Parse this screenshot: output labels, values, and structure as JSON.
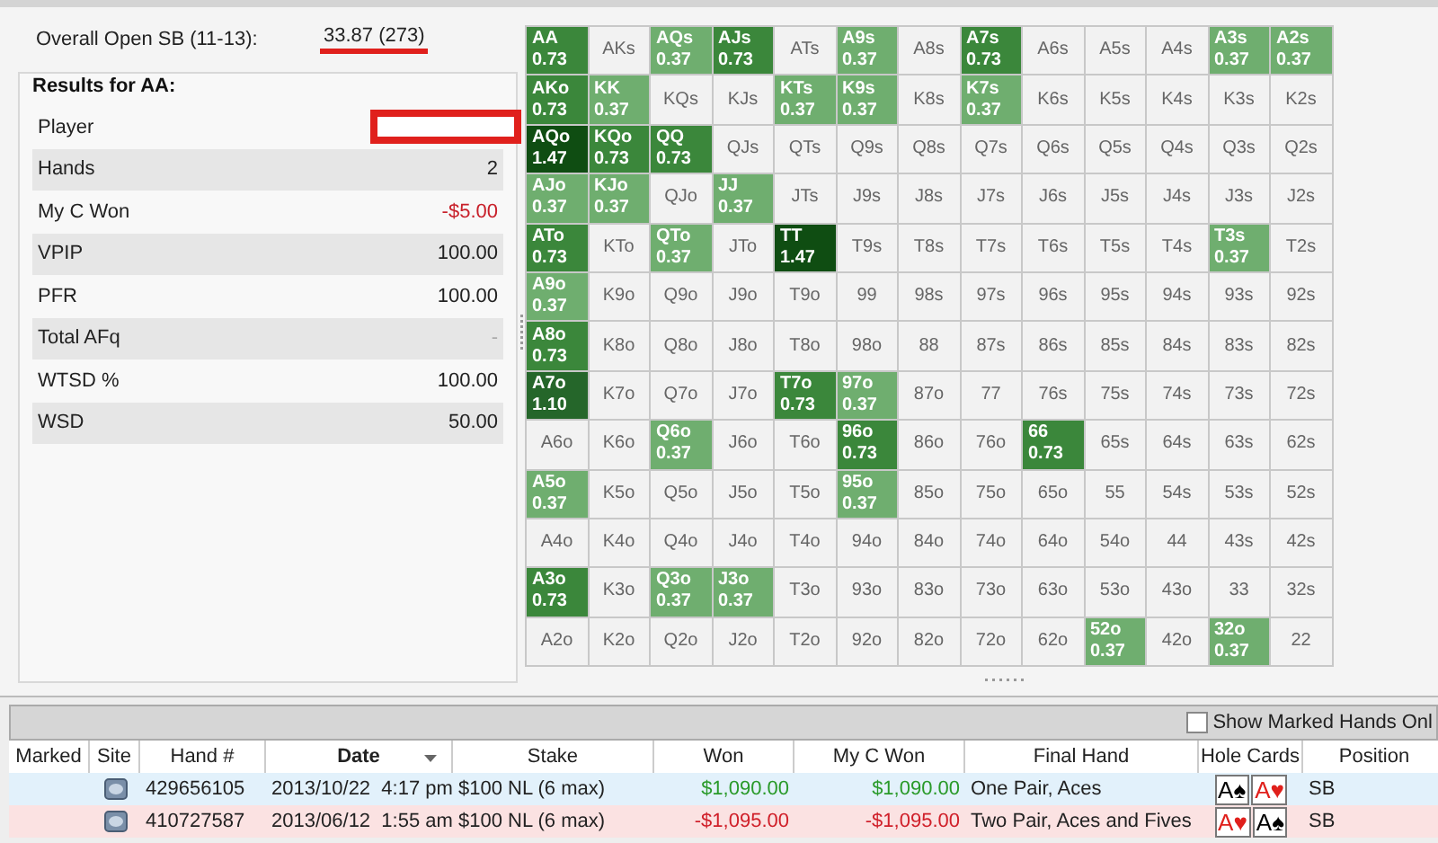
{
  "summary": {
    "label": "Overall Open SB (11-13):",
    "value": "33.87 (273)"
  },
  "results": {
    "title": "Results for AA:",
    "rows": [
      {
        "label": "Player",
        "kind": "redacted"
      },
      {
        "label": "Hands",
        "value": "2",
        "kind": "plain"
      },
      {
        "label": "My C Won",
        "value": "-$5.00",
        "kind": "negative"
      },
      {
        "label": "VPIP",
        "value": "100.00",
        "kind": "plain"
      },
      {
        "label": "PFR",
        "value": "100.00",
        "kind": "plain"
      },
      {
        "label": "Total AFq",
        "value": "-",
        "kind": "muted"
      },
      {
        "label": "WTSD %",
        "value": "100.00",
        "kind": "plain"
      },
      {
        "label": "WSD",
        "value": "50.00",
        "kind": "plain"
      }
    ]
  },
  "grid": [
    [
      {
        "hand": "AA",
        "value": "0.73",
        "color": "#3b873b"
      },
      {
        "hand": "AKs"
      },
      {
        "hand": "AQs",
        "value": "0.37",
        "color": "#6fae6f"
      },
      {
        "hand": "AJs",
        "value": "0.73",
        "color": "#3b873b"
      },
      {
        "hand": "ATs"
      },
      {
        "hand": "A9s",
        "value": "0.37",
        "color": "#6fae6f"
      },
      {
        "hand": "A8s"
      },
      {
        "hand": "A7s",
        "value": "0.73",
        "color": "#3b873b"
      },
      {
        "hand": "A6s"
      },
      {
        "hand": "A5s"
      },
      {
        "hand": "A4s"
      },
      {
        "hand": "A3s",
        "value": "0.37",
        "color": "#6fae6f"
      },
      {
        "hand": "A2s",
        "value": "0.37",
        "color": "#6fae6f"
      }
    ],
    [
      {
        "hand": "AKo",
        "value": "0.73",
        "color": "#3b873b"
      },
      {
        "hand": "KK",
        "value": "0.37",
        "color": "#6fae6f"
      },
      {
        "hand": "KQs"
      },
      {
        "hand": "KJs"
      },
      {
        "hand": "KTs",
        "value": "0.37",
        "color": "#6fae6f"
      },
      {
        "hand": "K9s",
        "value": "0.37",
        "color": "#6fae6f"
      },
      {
        "hand": "K8s"
      },
      {
        "hand": "K7s",
        "value": "0.37",
        "color": "#6fae6f"
      },
      {
        "hand": "K6s"
      },
      {
        "hand": "K5s"
      },
      {
        "hand": "K4s"
      },
      {
        "hand": "K3s"
      },
      {
        "hand": "K2s"
      }
    ],
    [
      {
        "hand": "AQo",
        "value": "1.47",
        "color": "#0f4d12"
      },
      {
        "hand": "KQo",
        "value": "0.73",
        "color": "#3b873b"
      },
      {
        "hand": "QQ",
        "value": "0.73",
        "color": "#3b873b"
      },
      {
        "hand": "QJs"
      },
      {
        "hand": "QTs"
      },
      {
        "hand": "Q9s"
      },
      {
        "hand": "Q8s"
      },
      {
        "hand": "Q7s"
      },
      {
        "hand": "Q6s"
      },
      {
        "hand": "Q5s"
      },
      {
        "hand": "Q4s"
      },
      {
        "hand": "Q3s"
      },
      {
        "hand": "Q2s"
      }
    ],
    [
      {
        "hand": "AJo",
        "value": "0.37",
        "color": "#6fae6f"
      },
      {
        "hand": "KJo",
        "value": "0.37",
        "color": "#6fae6f"
      },
      {
        "hand": "QJo"
      },
      {
        "hand": "JJ",
        "value": "0.37",
        "color": "#6fae6f"
      },
      {
        "hand": "JTs"
      },
      {
        "hand": "J9s"
      },
      {
        "hand": "J8s"
      },
      {
        "hand": "J7s"
      },
      {
        "hand": "J6s"
      },
      {
        "hand": "J5s"
      },
      {
        "hand": "J4s"
      },
      {
        "hand": "J3s"
      },
      {
        "hand": "J2s"
      }
    ],
    [
      {
        "hand": "ATo",
        "value": "0.73",
        "color": "#3b873b"
      },
      {
        "hand": "KTo"
      },
      {
        "hand": "QTo",
        "value": "0.37",
        "color": "#6fae6f"
      },
      {
        "hand": "JTo"
      },
      {
        "hand": "TT",
        "value": "1.47",
        "color": "#0f4d12"
      },
      {
        "hand": "T9s"
      },
      {
        "hand": "T8s"
      },
      {
        "hand": "T7s"
      },
      {
        "hand": "T6s"
      },
      {
        "hand": "T5s"
      },
      {
        "hand": "T4s"
      },
      {
        "hand": "T3s",
        "value": "0.37",
        "color": "#6fae6f"
      },
      {
        "hand": "T2s"
      }
    ],
    [
      {
        "hand": "A9o",
        "value": "0.37",
        "color": "#6fae6f"
      },
      {
        "hand": "K9o"
      },
      {
        "hand": "Q9o"
      },
      {
        "hand": "J9o"
      },
      {
        "hand": "T9o"
      },
      {
        "hand": "99"
      },
      {
        "hand": "98s"
      },
      {
        "hand": "97s"
      },
      {
        "hand": "96s"
      },
      {
        "hand": "95s"
      },
      {
        "hand": "94s"
      },
      {
        "hand": "93s"
      },
      {
        "hand": "92s"
      }
    ],
    [
      {
        "hand": "A8o",
        "value": "0.73",
        "color": "#3b873b"
      },
      {
        "hand": "K8o"
      },
      {
        "hand": "Q8o"
      },
      {
        "hand": "J8o"
      },
      {
        "hand": "T8o"
      },
      {
        "hand": "98o"
      },
      {
        "hand": "88"
      },
      {
        "hand": "87s"
      },
      {
        "hand": "86s"
      },
      {
        "hand": "85s"
      },
      {
        "hand": "84s"
      },
      {
        "hand": "83s"
      },
      {
        "hand": "82s"
      }
    ],
    [
      {
        "hand": "A7o",
        "value": "1.10",
        "color": "#25662a"
      },
      {
        "hand": "K7o"
      },
      {
        "hand": "Q7o"
      },
      {
        "hand": "J7o"
      },
      {
        "hand": "T7o",
        "value": "0.73",
        "color": "#3b873b"
      },
      {
        "hand": "97o",
        "value": "0.37",
        "color": "#6fae6f"
      },
      {
        "hand": "87o"
      },
      {
        "hand": "77"
      },
      {
        "hand": "76s"
      },
      {
        "hand": "75s"
      },
      {
        "hand": "74s"
      },
      {
        "hand": "73s"
      },
      {
        "hand": "72s"
      }
    ],
    [
      {
        "hand": "A6o"
      },
      {
        "hand": "K6o"
      },
      {
        "hand": "Q6o",
        "value": "0.37",
        "color": "#6fae6f"
      },
      {
        "hand": "J6o"
      },
      {
        "hand": "T6o"
      },
      {
        "hand": "96o",
        "value": "0.73",
        "color": "#3b873b"
      },
      {
        "hand": "86o"
      },
      {
        "hand": "76o"
      },
      {
        "hand": "66",
        "value": "0.73",
        "color": "#3b873b"
      },
      {
        "hand": "65s"
      },
      {
        "hand": "64s"
      },
      {
        "hand": "63s"
      },
      {
        "hand": "62s"
      }
    ],
    [
      {
        "hand": "A5o",
        "value": "0.37",
        "color": "#6fae6f"
      },
      {
        "hand": "K5o"
      },
      {
        "hand": "Q5o"
      },
      {
        "hand": "J5o"
      },
      {
        "hand": "T5o"
      },
      {
        "hand": "95o",
        "value": "0.37",
        "color": "#6fae6f"
      },
      {
        "hand": "85o"
      },
      {
        "hand": "75o"
      },
      {
        "hand": "65o"
      },
      {
        "hand": "55"
      },
      {
        "hand": "54s"
      },
      {
        "hand": "53s"
      },
      {
        "hand": "52s"
      }
    ],
    [
      {
        "hand": "A4o"
      },
      {
        "hand": "K4o"
      },
      {
        "hand": "Q4o"
      },
      {
        "hand": "J4o"
      },
      {
        "hand": "T4o"
      },
      {
        "hand": "94o"
      },
      {
        "hand": "84o"
      },
      {
        "hand": "74o"
      },
      {
        "hand": "64o"
      },
      {
        "hand": "54o"
      },
      {
        "hand": "44"
      },
      {
        "hand": "43s"
      },
      {
        "hand": "42s"
      }
    ],
    [
      {
        "hand": "A3o",
        "value": "0.73",
        "color": "#3b873b"
      },
      {
        "hand": "K3o"
      },
      {
        "hand": "Q3o",
        "value": "0.37",
        "color": "#6fae6f"
      },
      {
        "hand": "J3o",
        "value": "0.37",
        "color": "#6fae6f"
      },
      {
        "hand": "T3o"
      },
      {
        "hand": "93o"
      },
      {
        "hand": "83o"
      },
      {
        "hand": "73o"
      },
      {
        "hand": "63o"
      },
      {
        "hand": "53o"
      },
      {
        "hand": "43o"
      },
      {
        "hand": "33"
      },
      {
        "hand": "32s"
      }
    ],
    [
      {
        "hand": "A2o"
      },
      {
        "hand": "K2o"
      },
      {
        "hand": "Q2o"
      },
      {
        "hand": "J2o"
      },
      {
        "hand": "T2o"
      },
      {
        "hand": "92o"
      },
      {
        "hand": "82o"
      },
      {
        "hand": "72o"
      },
      {
        "hand": "62o"
      },
      {
        "hand": "52o",
        "value": "0.37",
        "color": "#6fae6f"
      },
      {
        "hand": "42o"
      },
      {
        "hand": "32o",
        "value": "0.37",
        "color": "#6fae6f"
      },
      {
        "hand": "22"
      }
    ]
  ],
  "marked_filter": {
    "label": "Show Marked Hands Onl",
    "checked": false
  },
  "hands_table": {
    "columns": [
      {
        "label": "Marked",
        "sorted": false
      },
      {
        "label": "Site",
        "sorted": false
      },
      {
        "label": "Hand #",
        "sorted": false
      },
      {
        "label": "Date",
        "sorted": true
      },
      {
        "label": "Stake",
        "sorted": false
      },
      {
        "label": "Won",
        "sorted": false
      },
      {
        "label": "My C Won",
        "sorted": false
      },
      {
        "label": "Final Hand",
        "sorted": false
      },
      {
        "label": "Hole Cards",
        "sorted": false
      },
      {
        "label": "Position",
        "sorted": false
      }
    ],
    "rows": [
      {
        "kind": "win",
        "hand_no": "429656105",
        "date": "2013/10/22  4:17 pm",
        "stake": "$100 NL (6 max)",
        "won": "$1,090.00",
        "my_c_won": "$1,090.00",
        "final_hand": "One Pair, Aces",
        "hole_cards": [
          {
            "rank": "A",
            "suit": "♠",
            "color": "#000000"
          },
          {
            "rank": "A",
            "suit": "♥",
            "color": "#e0201c"
          }
        ],
        "position": "SB"
      },
      {
        "kind": "loss",
        "hand_no": "410727587",
        "date": "2013/06/12  1:55 am",
        "stake": "$100 NL (6 max)",
        "won": "-$1,095.00",
        "my_c_won": "-$1,095.00",
        "final_hand": "Two Pair, Aces and Fives",
        "hole_cards": [
          {
            "rank": "A",
            "suit": "♥",
            "color": "#e0201c"
          },
          {
            "rank": "A",
            "suit": "♠",
            "color": "#000000"
          }
        ],
        "position": "SB"
      }
    ]
  }
}
